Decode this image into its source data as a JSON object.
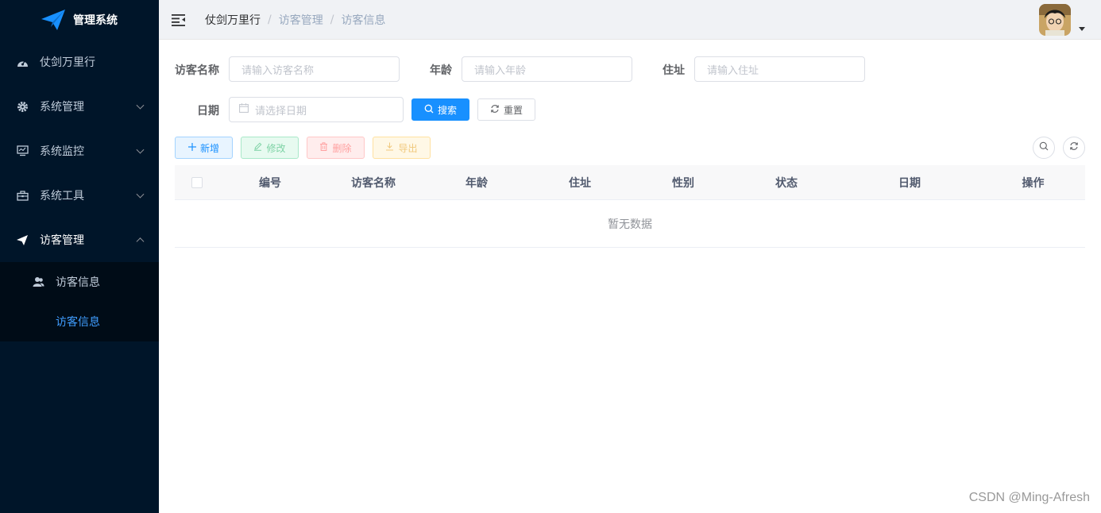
{
  "sidebar": {
    "logo_text": "管理系统",
    "items": [
      {
        "label": "仗剑万里行",
        "icon": "dashboard-icon"
      },
      {
        "label": "系统管理",
        "icon": "gear-icon"
      },
      {
        "label": "系统监控",
        "icon": "monitor-icon"
      },
      {
        "label": "系统工具",
        "icon": "toolbox-icon"
      },
      {
        "label": "访客管理",
        "icon": "paper-plane-icon"
      }
    ],
    "submenu": {
      "label": "访客信息",
      "icon": "user-group-icon",
      "child_label": "访客信息"
    }
  },
  "navbar": {
    "breadcrumb": [
      "仗剑万里行",
      "访客管理",
      "访客信息"
    ],
    "separator": "/"
  },
  "search_form": {
    "name_label": "访客名称",
    "name_placeholder": "请输入访客名称",
    "age_label": "年龄",
    "age_placeholder": "请输入年龄",
    "address_label": "住址",
    "address_placeholder": "请输入住址",
    "date_label": "日期",
    "date_placeholder": "请选择日期",
    "search_button": "搜索",
    "reset_button": "重置"
  },
  "toolbar": {
    "add": "新增",
    "edit": "修改",
    "delete": "删除",
    "export": "导出"
  },
  "table": {
    "columns": [
      "编号",
      "访客名称",
      "年龄",
      "住址",
      "性别",
      "状态",
      "日期",
      "操作"
    ],
    "empty_text": "暂无数据"
  },
  "watermark": "CSDN @Ming-Afresh",
  "colors": {
    "sidebar_bg": "#001529",
    "primary": "#1890ff",
    "active_link": "#409eff"
  }
}
